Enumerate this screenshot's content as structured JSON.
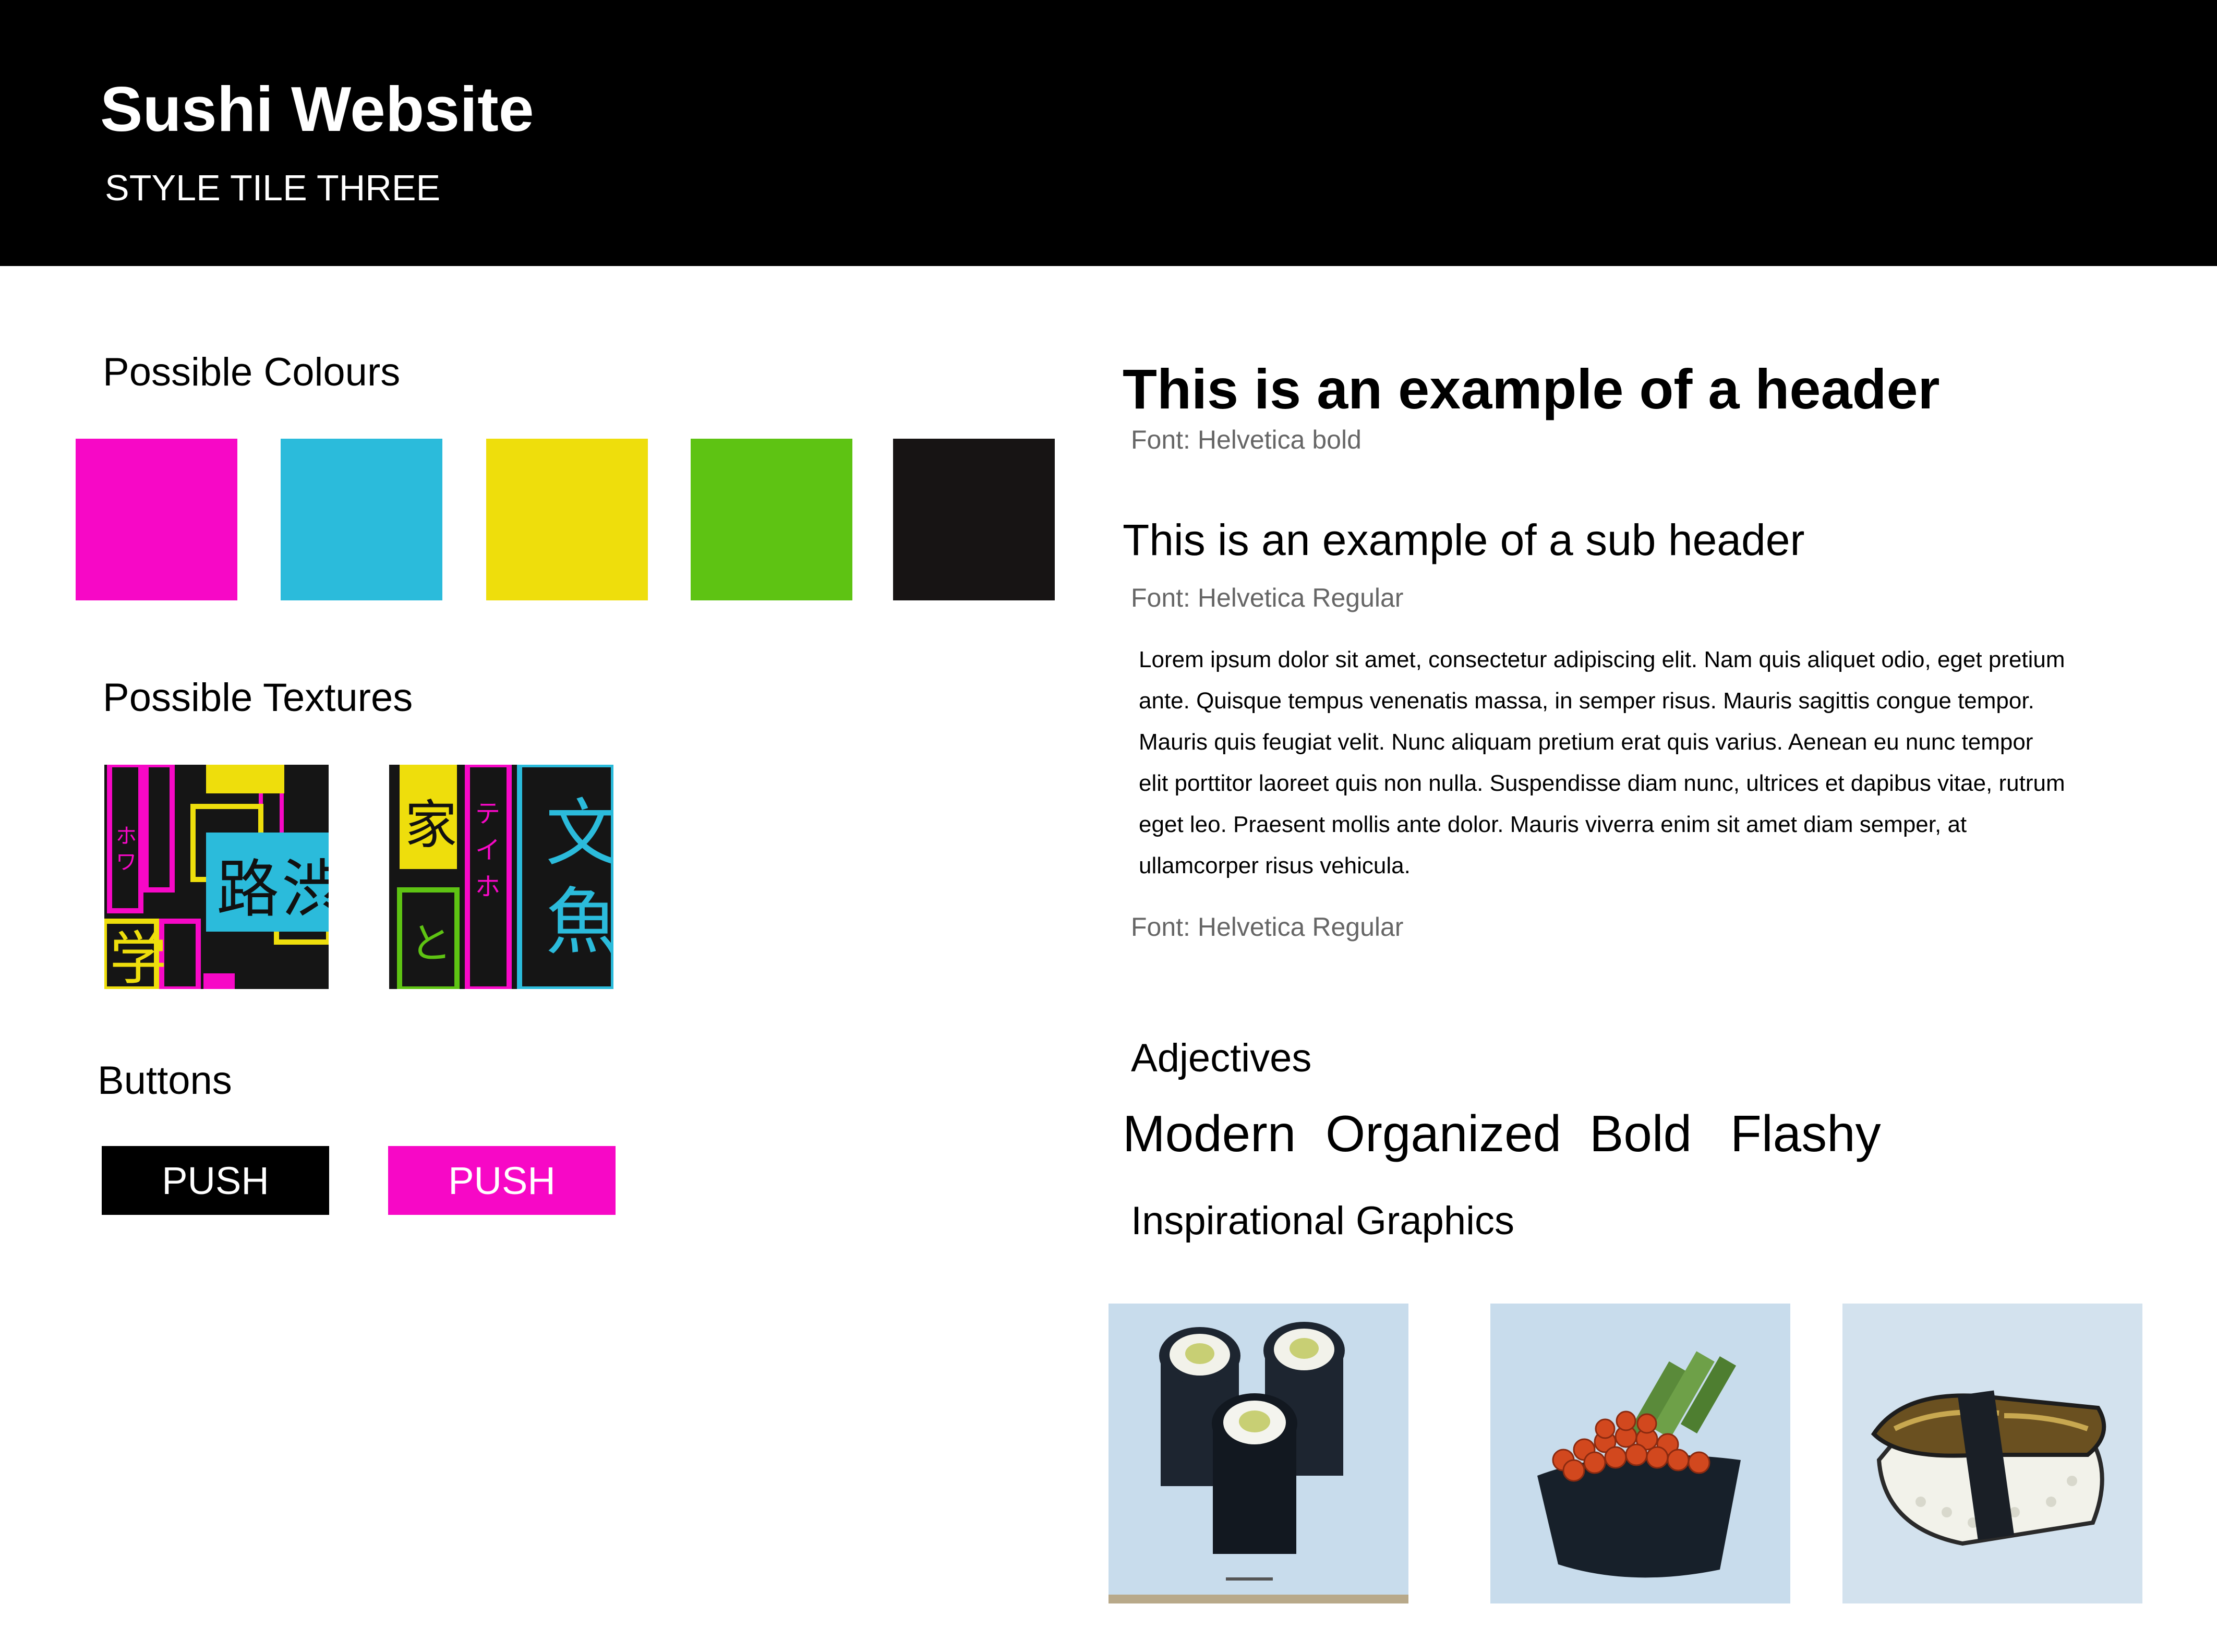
{
  "header": {
    "title": "Sushi Website",
    "subtitle": "STYLE TILE THREE"
  },
  "colours": {
    "heading": "Possible Colours",
    "swatches": [
      "#f708c6",
      "#2bbbdb",
      "#eede0c",
      "#5ec313",
      "#171414"
    ]
  },
  "textures": {
    "heading": "Possible Textures",
    "tiles": [
      "neon-kanji-texture-1",
      "neon-kanji-texture-2"
    ]
  },
  "buttons": {
    "heading": "Buttons",
    "primary_label": "PUSH",
    "secondary_label": "PUSH",
    "primary_color": "#000000",
    "secondary_color": "#f708c6"
  },
  "typography": {
    "header_example": "This is an example of a header",
    "header_font": "Font: Helvetica bold",
    "subheader_example": "This is an example of a sub header",
    "subheader_font": "Font: Helvetica Regular",
    "body_example": "Lorem ipsum dolor sit amet, consectetur adipiscing elit. Nam quis aliquet odio, eget pretium ante. Quisque tempus venenatis massa, in semper risus. Mauris sagittis congue tempor. Mauris quis feugiat velit. Nunc aliquam pretium erat quis varius. Aenean eu nunc tempor elit porttitor laoreet quis non nulla. Suspendisse diam nunc, ultrices et dapibus vitae, rutrum eget leo. Praesent mollis ante dolor. Mauris viverra enim sit amet diam semper, at ullamcorper risus vehicula.",
    "body_font": "Font: Helvetica Regular"
  },
  "adjectives": {
    "heading": "Adjectives",
    "items": [
      "Modern",
      "Organized",
      "Bold",
      "Flashy"
    ]
  },
  "graphics": {
    "heading": "Inspirational Graphics",
    "images": [
      "maki-roll-illustration",
      "ikura-gunkan-illustration",
      "unagi-nigiri-illustration"
    ]
  }
}
